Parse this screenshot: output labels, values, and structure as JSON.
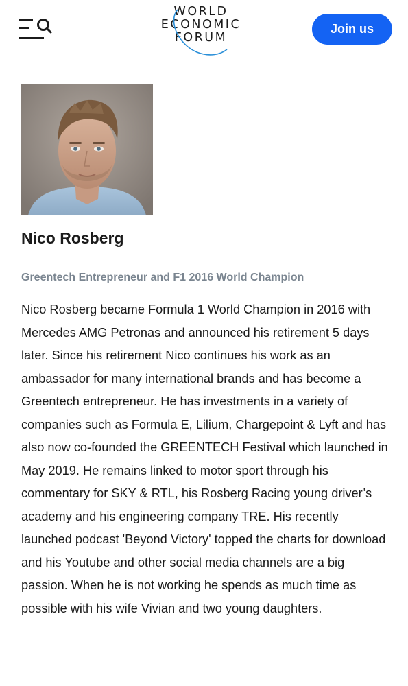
{
  "header": {
    "menu_icon": "menu-search-icon",
    "logo": {
      "line1": "WORLD",
      "line2": "ECONOMIC",
      "line3": "FORUM"
    },
    "join_label": "Join us",
    "accent": "#1463f3"
  },
  "profile": {
    "portrait_icon": "portrait-photo",
    "name": "Nico Rosberg",
    "role": "Greentech Entrepreneur and F1 2016 World Champion",
    "bio": "Nico Rosberg became Formula 1 World Champion in 2016 with Mercedes AMG Petronas and announced his retirement 5 days later. Since his retirement Nico continues his work as an ambassador for many international brands and has become a Greentech entrepreneur. He has investments in a variety of companies such as Formula E, Lilium, Chargepoint & Lyft and has also now co-founded the GREENTECH Festival which launched in May 2019. He remains linked to motor sport through his commentary for SKY & RTL, his Rosberg Racing young driver’s academy and his engineering company TRE. His recently launched podcast 'Beyond Victory' topped the charts for download and his Youtube and other social media channels are a big passion. When he is not working he spends as much time as possible with his wife Vivian and two young daughters."
  }
}
